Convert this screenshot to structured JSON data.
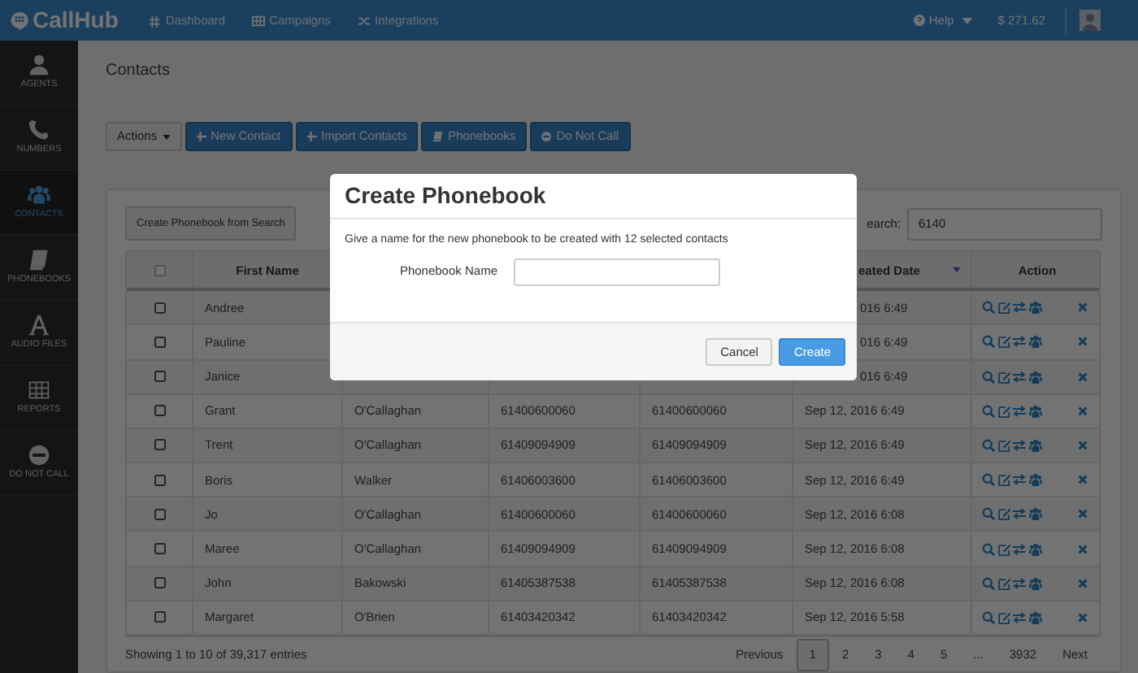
{
  "header": {
    "logo": "CallHub",
    "nav": [
      "Dashboard",
      "Campaigns",
      "Integrations"
    ],
    "help": "Help",
    "balance": "$ 271.62"
  },
  "sidebar": {
    "items": [
      {
        "label": "AGENTS",
        "selected": false
      },
      {
        "label": "NUMBERS",
        "selected": false
      },
      {
        "label": "CONTACTS",
        "selected": true
      },
      {
        "label": "PHONEBOOKS",
        "selected": false
      },
      {
        "label": "AUDIO FILES",
        "selected": false
      },
      {
        "label": "REPORTS",
        "selected": false
      },
      {
        "label": "DO NOT CALL",
        "selected": false
      }
    ]
  },
  "page_title": "Contacts",
  "toolbar": {
    "actions": "Actions",
    "buttons": [
      "New Contact",
      "Import Contacts",
      "Phonebooks",
      "Do Not Call"
    ]
  },
  "table_panel": {
    "create_from_search": "Create Phonebook from Search",
    "search_label": "earch:",
    "search_value": "6140",
    "select_all_checked": false,
    "columns": {
      "first_name": "First Name",
      "created_date": "eated Date",
      "action": "Action"
    },
    "rows": [
      {
        "checked": false,
        "first_name": "Andree",
        "created_date": "016 6:49"
      },
      {
        "checked": false,
        "first_name": "Pauline",
        "created_date": "016 6:49"
      },
      {
        "checked": false,
        "first_name": "Janice",
        "created_date": "016 6:49"
      },
      {
        "checked": false,
        "first_name": "Grant",
        "last_name": "O'Callaghan",
        "column_3": "61400600060",
        "column_4": "61400600060",
        "created_date": "Sep 12, 2016 6:49"
      },
      {
        "checked": false,
        "first_name": "Trent",
        "last_name": "O'Callaghan",
        "column_3": "61409094909",
        "column_4": "61409094909",
        "created_date": "Sep 12, 2016 6:49"
      },
      {
        "checked": false,
        "first_name": "Boris",
        "last_name": "Walker",
        "column_3": "61406003600",
        "column_4": "61406003600",
        "created_date": "Sep 12, 2016 6:49"
      },
      {
        "checked": false,
        "first_name": "Jo",
        "last_name": "O'Callaghan",
        "column_3": "61400600060",
        "column_4": "61400600060",
        "created_date": "Sep 12, 2016 6:08"
      },
      {
        "checked": false,
        "first_name": "Maree",
        "last_name": "O'Callaghan",
        "column_3": "61409094909",
        "column_4": "61409094909",
        "created_date": "Sep 12, 2016 6:08"
      },
      {
        "checked": false,
        "first_name": "John",
        "last_name": "Bakowski",
        "column_3": "61405387538",
        "column_4": "61405387538",
        "created_date": "Sep 12, 2016 6:08"
      },
      {
        "checked": false,
        "first_name": "Margaret",
        "last_name": "O'Brien",
        "column_3": "61403420342",
        "column_4": "61403420342",
        "created_date": "Sep 12, 2016 5:58"
      }
    ],
    "footer": "Showing 1 to 10 of 39,317 entries",
    "pagination": [
      {
        "label": "Previous",
        "selected": false
      },
      {
        "label": "1",
        "selected": true
      },
      {
        "label": "2",
        "selected": false
      },
      {
        "label": "3",
        "selected": false
      },
      {
        "label": "4",
        "selected": false
      },
      {
        "label": "5",
        "selected": false
      },
      {
        "label": "...",
        "selected": false
      },
      {
        "label": "3932",
        "selected": false
      },
      {
        "label": "Next",
        "selected": false
      }
    ]
  },
  "dialog": {
    "title": "Create Phonebook",
    "message": "Give a name for the new phonebook to be created with 12 selected contacts",
    "field_label": "Phonebook Name",
    "cancel": "Cancel",
    "create": "Create"
  }
}
